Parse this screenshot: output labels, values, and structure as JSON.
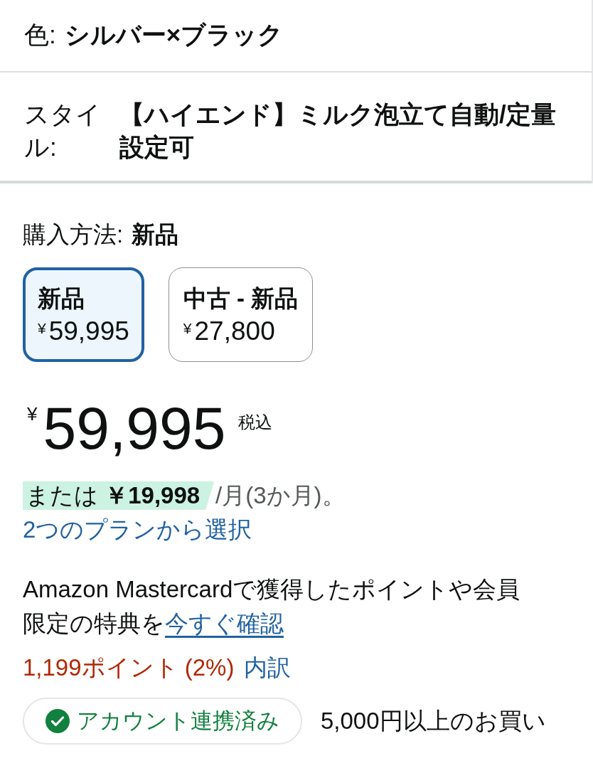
{
  "color": {
    "label": "色:",
    "value": "シルバー×ブラック"
  },
  "style": {
    "label": "スタイル:",
    "value": "【ハイエンド】ミルク泡立て自動/定量設定可"
  },
  "purchase_method": {
    "label": "購入方法:",
    "value": "新品"
  },
  "options": [
    {
      "name": "新品",
      "currency": "¥",
      "price": "59,995",
      "selected": true
    },
    {
      "name": "中古 - 新品",
      "currency": "¥",
      "price": "27,800",
      "selected": false
    }
  ],
  "price": {
    "currency": "¥",
    "amount": "59,995",
    "tax_note": "税込"
  },
  "installment": {
    "offer": "または **￥19,998**",
    "period": "/月(3か月)。",
    "plans_link": "2つのプランから選択"
  },
  "card_promo": {
    "text": "Amazon Mastercardで獲得したポイントや会員限定の特典を",
    "link": "今すぐ確認"
  },
  "points": {
    "text": "1,199ポイント (2%)",
    "link": "内訳"
  },
  "account": {
    "label": "アカウント連携済み",
    "linked": true
  },
  "promo_text": "5,000円以上のお買い"
}
